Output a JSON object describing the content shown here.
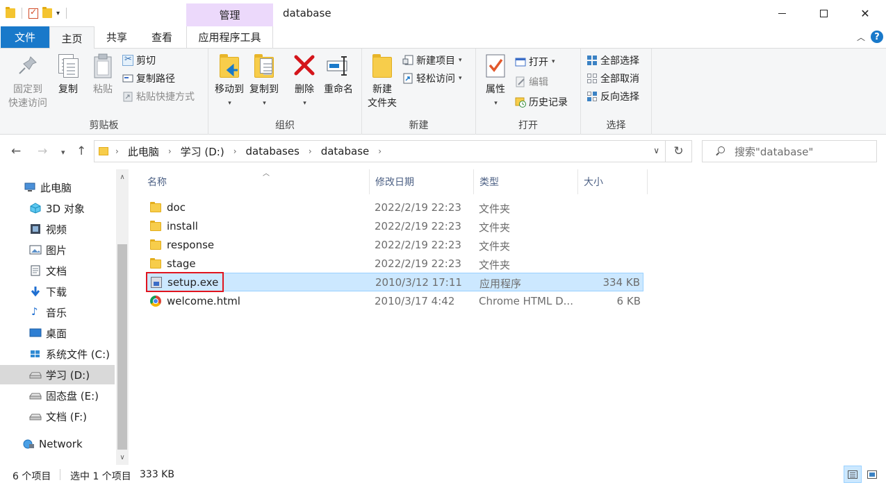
{
  "window": {
    "title": "database",
    "context_tab_header": "管理"
  },
  "colors": {
    "file_tab": "#1979ca",
    "context_tab": "#ecd9fb",
    "selection": "#cce8ff",
    "highlight_box": "#e0141e"
  },
  "tabs": {
    "file": "文件",
    "home": "主页",
    "share": "共享",
    "view": "查看",
    "app_tools": "应用程序工具"
  },
  "ribbon": {
    "clipboard": {
      "label": "剪贴板",
      "pin_quick_access": "固定到",
      "pin_quick_access_2": "快速访问",
      "copy": "复制",
      "paste": "粘贴",
      "cut": "剪切",
      "copy_path": "复制路径",
      "paste_shortcut": "粘贴快捷方式"
    },
    "organize": {
      "label": "组织",
      "move_to": "移动到",
      "copy_to": "复制到",
      "delete": "删除",
      "rename": "重命名"
    },
    "new": {
      "label": "新建",
      "new_folder": "新建",
      "new_folder_2": "文件夹",
      "new_item": "新建项目",
      "easy_access": "轻松访问"
    },
    "open": {
      "label": "打开",
      "properties": "属性",
      "open": "打开",
      "edit": "编辑",
      "history": "历史记录"
    },
    "select": {
      "label": "选择",
      "select_all": "全部选择",
      "select_none": "全部取消",
      "invert": "反向选择"
    }
  },
  "address": {
    "crumbs": [
      "此电脑",
      "学习 (D:)",
      "databases",
      "database"
    ],
    "search_placeholder": "搜索\"database\""
  },
  "nav": {
    "items": [
      {
        "label": "此电脑",
        "icon": "pc-icon"
      },
      {
        "label": "3D 对象",
        "icon": "3d-objects-icon"
      },
      {
        "label": "视频",
        "icon": "video-icon"
      },
      {
        "label": "图片",
        "icon": "pictures-icon"
      },
      {
        "label": "文档",
        "icon": "documents-icon"
      },
      {
        "label": "下载",
        "icon": "download-icon"
      },
      {
        "label": "音乐",
        "icon": "music-icon"
      },
      {
        "label": "桌面",
        "icon": "desktop-icon"
      },
      {
        "label": "系统文件 (C:)",
        "icon": "windows-drive-icon"
      },
      {
        "label": "学习 (D:)",
        "icon": "drive-icon"
      },
      {
        "label": "固态盘 (E:)",
        "icon": "drive-icon"
      },
      {
        "label": "文档 (F:)",
        "icon": "drive-icon"
      },
      {
        "label": "Network",
        "icon": "network-icon"
      }
    ]
  },
  "columns": {
    "name": "名称",
    "date": "修改日期",
    "type": "类型",
    "size": "大小"
  },
  "files": [
    {
      "name": "doc",
      "date": "2022/2/19 22:23",
      "type": "文件夹",
      "size": "",
      "icon": "folder-icon"
    },
    {
      "name": "install",
      "date": "2022/2/19 22:23",
      "type": "文件夹",
      "size": "",
      "icon": "folder-icon"
    },
    {
      "name": "response",
      "date": "2022/2/19 22:23",
      "type": "文件夹",
      "size": "",
      "icon": "folder-icon"
    },
    {
      "name": "stage",
      "date": "2022/2/19 22:23",
      "type": "文件夹",
      "size": "",
      "icon": "folder-icon"
    },
    {
      "name": "setup.exe",
      "date": "2010/3/12 17:11",
      "type": "应用程序",
      "size": "334 KB",
      "icon": "exe-icon"
    },
    {
      "name": "welcome.html",
      "date": "2010/3/17 4:42",
      "type": "Chrome HTML D...",
      "size": "6 KB",
      "icon": "chrome-html-icon"
    }
  ],
  "status": {
    "count": "6 个项目",
    "selected": "选中 1 个项目",
    "selected_size": "333 KB"
  }
}
